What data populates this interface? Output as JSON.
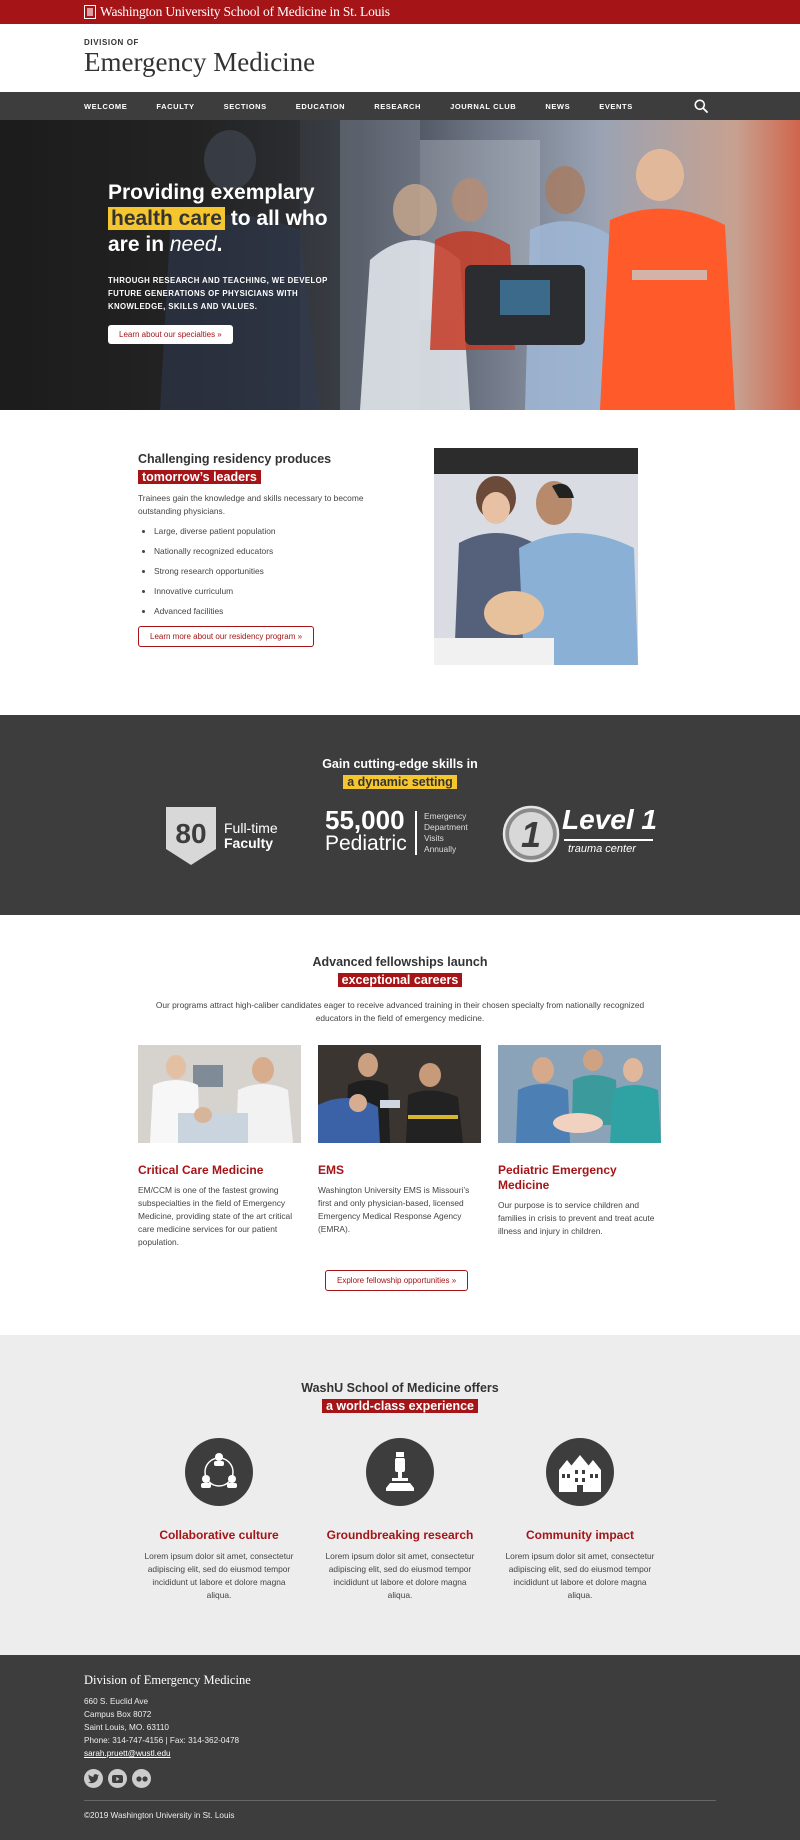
{
  "topbar": {
    "wordmark": "Washington University School of Medicine in St. Louis"
  },
  "header": {
    "kicker": "DIVISION OF",
    "title": "Emergency Medicine"
  },
  "nav": {
    "items": [
      "WELCOME",
      "FACULTY",
      "SECTIONS",
      "EDUCATION",
      "RESEARCH",
      "JOURNAL CLUB",
      "NEWS",
      "EVENTS"
    ],
    "search_icon": "search-icon"
  },
  "hero": {
    "line1": "Providing exemplary",
    "highlight": "health care",
    "line2": "to all who",
    "line3": "are in",
    "emphasis": "need",
    "period": ".",
    "subhead": "THROUGH RESEARCH AND TEACHING, WE DEVELOP FUTURE GENERATIONS OF PHYSICIANS WITH KNOWLEDGE, SKILLS AND VALUES.",
    "button": "Learn about our specialties »"
  },
  "residency": {
    "heading": "Challenging residency produces",
    "highlight": "tomorrow’s leaders",
    "body": "Trainees gain the knowledge and skills necessary to become outstanding physicians.",
    "bullets": [
      "Large, diverse patient population",
      "Nationally recognized educators",
      "Strong research opportunities",
      "Innovative curriculum",
      "Advanced facilities"
    ],
    "button": "Learn more about our residency program »"
  },
  "stats": {
    "heading": "Gain cutting-edge skills in",
    "highlight": "a dynamic setting",
    "faculty_number": "80",
    "faculty_line1": "Full-time",
    "faculty_line2": "Faculty",
    "ped_number": "55,000",
    "ped_word": "Pediatric",
    "ped_desc": [
      "Emergency",
      "Department",
      "Visits",
      "Annually"
    ],
    "level_digit": "1",
    "level_text": "Level 1",
    "level_sub": "trauma center"
  },
  "fellowships": {
    "heading": "Advanced fellowships launch",
    "highlight": "exceptional careers",
    "lead": "Our programs attract high-caliber candidates eager to receive advanced training in their chosen specialty from nationally recognized educators in the field of emergency medicine.",
    "cards": [
      {
        "title": "Critical Care Medicine",
        "body": "EM/CCM is one of the fastest growing subspecialties in the field of Emergency Medicine,  providing state of the art critical care medicine services for our patient population."
      },
      {
        "title": "EMS",
        "body": "Washington University EMS is Missouri’s first and only physician-based, licensed Emergency Medical Response Agency (EMRA)."
      },
      {
        "title": "Pediatric Emergency Medicine",
        "body": "Our purpose is to service children and families in crisis to prevent and treat acute illness and injury in children."
      }
    ],
    "button": "Explore fellowship opportunities »"
  },
  "world": {
    "heading": "WashU School of Medicine offers",
    "highlight": "a world-class experience",
    "features": [
      {
        "icon": "people-network-icon",
        "title": "Collaborative culture",
        "body": "Lorem ipsum dolor sit amet, consectetur adipiscing elit, sed do eiusmod tempor incididunt ut labore et dolore magna aliqua."
      },
      {
        "icon": "microscope-icon",
        "title": "Groundbreaking research",
        "body": "Lorem ipsum dolor sit amet, consectetur adipiscing elit, sed do eiusmod tempor incididunt ut labore et dolore magna aliqua."
      },
      {
        "icon": "buildings-icon",
        "title": "Community impact",
        "body": "Lorem ipsum dolor sit amet, consectetur adipiscing elit, sed do eiusmod tempor incididunt ut labore et dolore magna aliqua."
      }
    ]
  },
  "footer": {
    "org": "Division of Emergency Medicine",
    "address1": "660 S. Euclid Ave",
    "address2": "Campus Box 8072",
    "address3": "Saint Louis, MO. 63110",
    "phone": "Phone: 314-747-4156  |  Fax: 314-362-0478",
    "email": "sarah.pruett@wustl.edu",
    "social": [
      "twitter-icon",
      "youtube-icon",
      "flickr-icon"
    ],
    "copyright": "©2019 Washington University in St. Louis"
  },
  "colors": {
    "brand_red": "#a51417",
    "highlight_yellow": "#f6c62f",
    "dark_gray": "#3d3d3d",
    "light_gray": "#ededed"
  }
}
